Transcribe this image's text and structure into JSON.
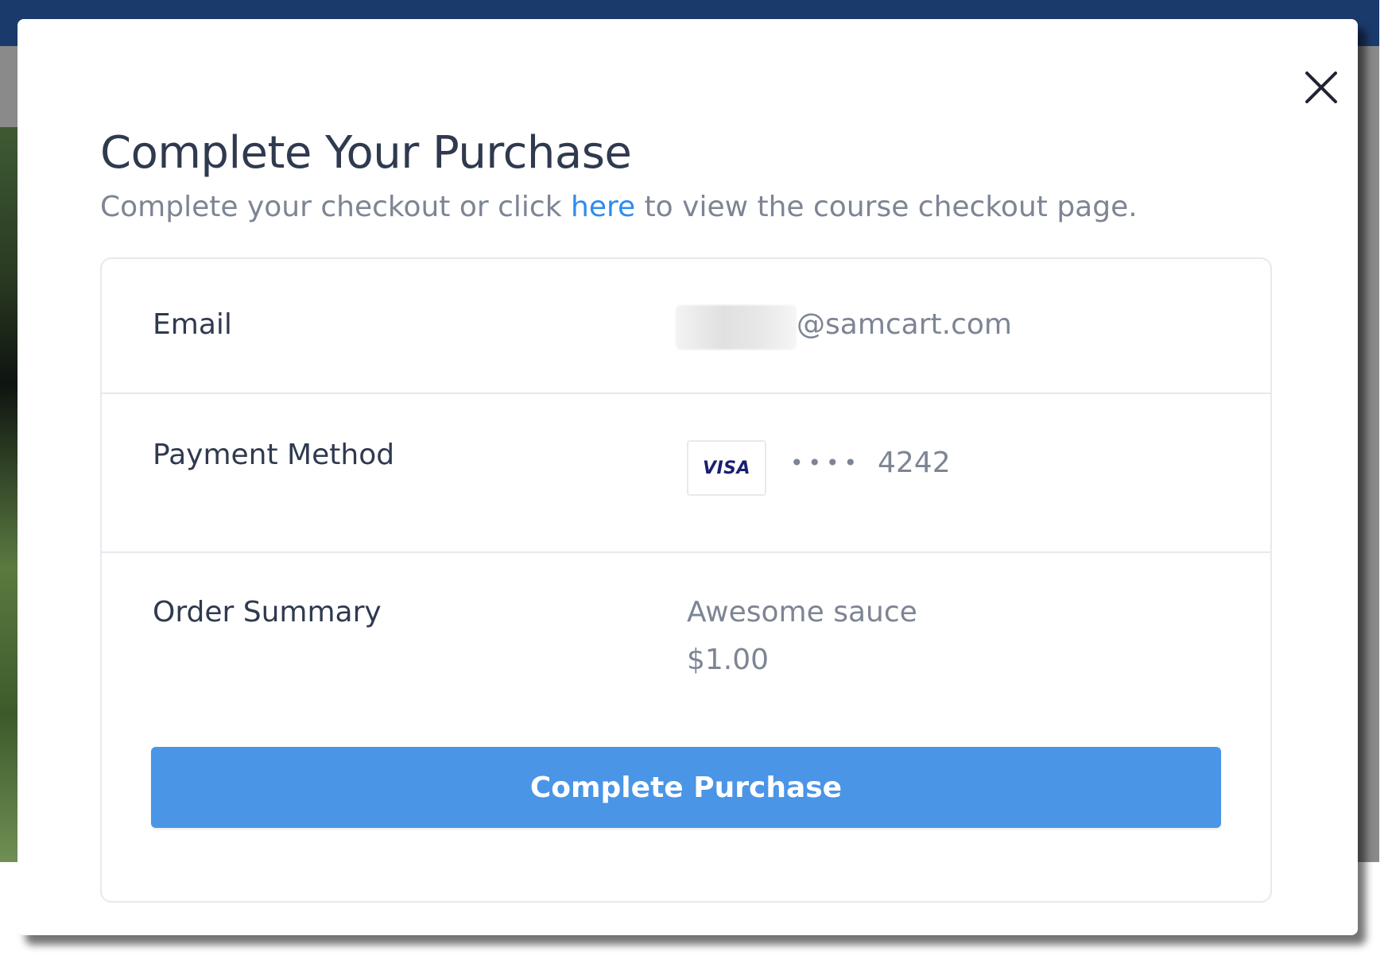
{
  "modal": {
    "title": "Complete Your Purchase",
    "subtitle_before": "Complete your checkout or click ",
    "subtitle_link": "here",
    "subtitle_after": " to view the course checkout page."
  },
  "details": {
    "email_label": "Email",
    "email_value": "@samcart.com",
    "payment_label": "Payment Method",
    "card_brand": "VISA",
    "card_dots": "••••",
    "card_last4": "4242",
    "summary_label": "Order Summary",
    "product_name": "Awesome sauce",
    "product_price": "$1.00"
  },
  "actions": {
    "purchase_label": "Complete Purchase"
  },
  "colors": {
    "accent": "#4a95e6",
    "link": "#2e8bef",
    "title": "#2f3a4f",
    "muted": "#7d8594",
    "header_bar": "#1b3a6c"
  },
  "icons": {
    "close": "close-icon"
  }
}
